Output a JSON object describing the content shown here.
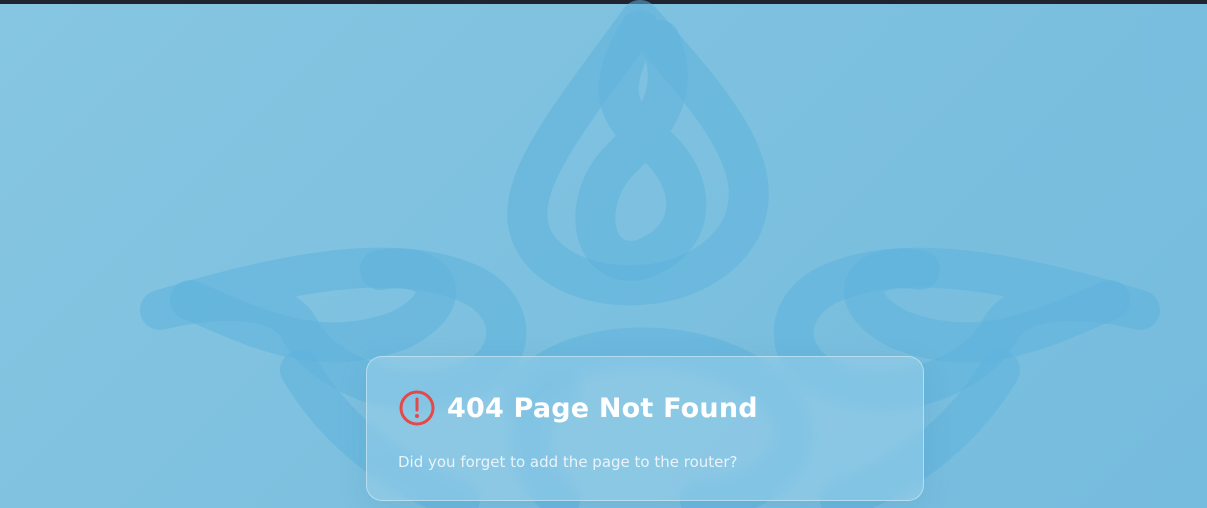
{
  "error": {
    "title": "404 Page Not Found",
    "message": "Did you forget to add the page to the router?",
    "icon": "alert-circle-icon",
    "icon_color": "#e54848"
  },
  "theme": {
    "background": "#7fc2e0",
    "logo_color": "#5fb3dc",
    "top_bar": "#1f2430"
  },
  "background_logo": {
    "icon": "knot-lotus-logo"
  }
}
